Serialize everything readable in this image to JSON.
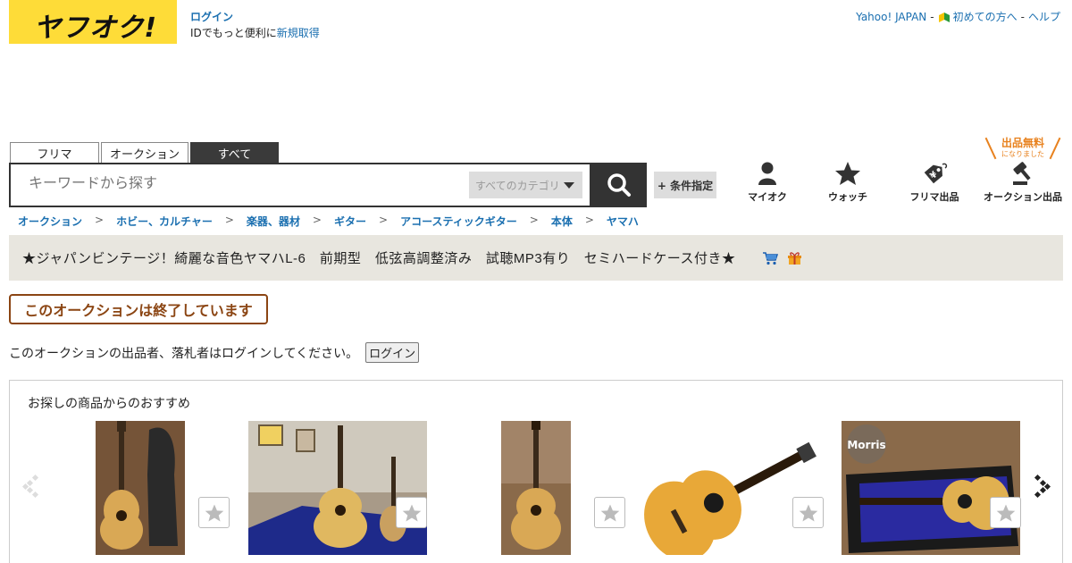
{
  "header": {
    "logo_text": "ヤフオク!",
    "login_link": "ログイン",
    "login_prompt": "IDでもっと便利に",
    "register_link": "新規取得",
    "top_links": [
      "Yahoo! JAPAN",
      "初めての方へ",
      "ヘルプ"
    ]
  },
  "search": {
    "tabs": [
      "フリマ",
      "オークション",
      "すべて"
    ],
    "active_tab": "すべて",
    "placeholder": "キーワードから探す",
    "category_select": "すべてのカテゴリ",
    "condition_button": "+ 条件指定"
  },
  "nav": {
    "myauc": "マイオク",
    "watch": "ウォッチ",
    "flea_sell": "フリマ出品",
    "auction_sell": "オークション出品",
    "free_badge_main": "出品無料",
    "free_badge_sub": "になりました"
  },
  "breadcrumb": [
    "オークション",
    "ホビー、カルチャー",
    "楽器、器材",
    "ギター",
    "アコースティックギター",
    "本体",
    "ヤマハ"
  ],
  "item": {
    "title": "★ジャパンビンテージ！綺麗な音色ヤマハL-6　前期型　低弦高調整済み　試聴MP3有り　セミハードケース付き★"
  },
  "notice": {
    "ended": "このオークションは終了しています",
    "login_text": "このオークションの出品者、落札者はログインしてください。",
    "login_button": "ログイン"
  },
  "recommend": {
    "heading": "お探しの商品からのおすすめ",
    "items": [
      {
        "name": "recommended-guitar-1"
      },
      {
        "name": "recommended-guitar-2"
      },
      {
        "name": "recommended-guitar-3"
      },
      {
        "name": "recommended-guitar-4"
      },
      {
        "name": "recommended-guitar-5"
      }
    ]
  },
  "colors": {
    "logo_yellow": "#fedc38",
    "link_blue": "#1a6fb0",
    "ended_brown": "#8b4513",
    "free_orange": "#e8821f",
    "title_bar": "#e8e6df"
  }
}
